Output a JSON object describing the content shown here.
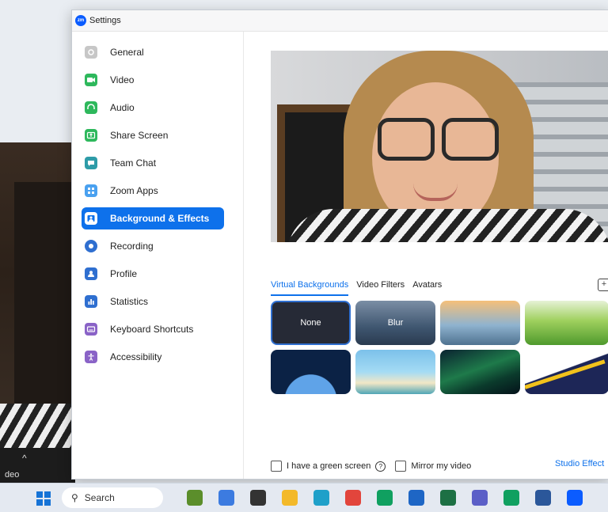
{
  "window": {
    "title": "Settings",
    "logo_text": "zm"
  },
  "meeting_bg": {
    "toolbar_label": "deo",
    "caret": "^"
  },
  "sidebar": {
    "items": [
      {
        "label": "General",
        "color": "#c7c7c7",
        "icon": "gear-icon"
      },
      {
        "label": "Video",
        "color": "#2eb85c",
        "icon": "camera-icon"
      },
      {
        "label": "Audio",
        "color": "#2eb85c",
        "icon": "headphones-icon"
      },
      {
        "label": "Share Screen",
        "color": "#2eb85c",
        "icon": "share-screen-icon"
      },
      {
        "label": "Team Chat",
        "color": "#2e9ca8",
        "icon": "chat-icon"
      },
      {
        "label": "Zoom Apps",
        "color": "#4aa1f0",
        "icon": "apps-icon"
      },
      {
        "label": "Background & Effects",
        "color": "#0e71eb",
        "icon": "background-icon",
        "active": true
      },
      {
        "label": "Recording",
        "color": "#2f6fd0",
        "icon": "record-icon"
      },
      {
        "label": "Profile",
        "color": "#2f6fd0",
        "icon": "profile-icon"
      },
      {
        "label": "Statistics",
        "color": "#2f6fd0",
        "icon": "statistics-icon"
      },
      {
        "label": "Keyboard Shortcuts",
        "color": "#8a63c7",
        "icon": "keyboard-icon"
      },
      {
        "label": "Accessibility",
        "color": "#8a63c7",
        "icon": "accessibility-icon"
      }
    ]
  },
  "content": {
    "tabs": [
      "Virtual Backgrounds",
      "Video Filters",
      "Avatars"
    ],
    "active_tab": "Virtual Backgrounds",
    "backgrounds": [
      {
        "label": "None",
        "selected": true
      },
      {
        "label": "Blur"
      },
      {
        "label": ""
      },
      {
        "label": ""
      },
      {
        "label": ""
      },
      {
        "label": ""
      },
      {
        "label": ""
      },
      {
        "label": ""
      }
    ],
    "green_screen_label": "I have a green screen",
    "mirror_label": "Mirror my video",
    "studio_effects_label": "Studio Effect",
    "help_glyph": "?"
  },
  "taskbar": {
    "search_label": "Search",
    "apps": [
      {
        "icon": "frog-icon",
        "color": "#5b8e2b"
      },
      {
        "icon": "puzzle-icon",
        "color": "#3c7be0"
      },
      {
        "icon": "task-view-icon",
        "color": "#333333"
      },
      {
        "icon": "file-explorer-icon",
        "color": "#f3b92a"
      },
      {
        "icon": "copilot-icon",
        "color": "#1fa0c9"
      },
      {
        "icon": "chrome-icon",
        "color": "#e2453c"
      },
      {
        "icon": "green-app-icon",
        "color": "#10a060"
      },
      {
        "icon": "outlook-icon",
        "color": "#1e66c5"
      },
      {
        "icon": "excel-icon",
        "color": "#1d7044"
      },
      {
        "icon": "teams-icon",
        "color": "#5b5fc7"
      },
      {
        "icon": "green-app-2-icon",
        "color": "#10a060"
      },
      {
        "icon": "word-icon",
        "color": "#2b579a"
      },
      {
        "icon": "zoom-icon",
        "color": "#0b5cff"
      }
    ]
  }
}
